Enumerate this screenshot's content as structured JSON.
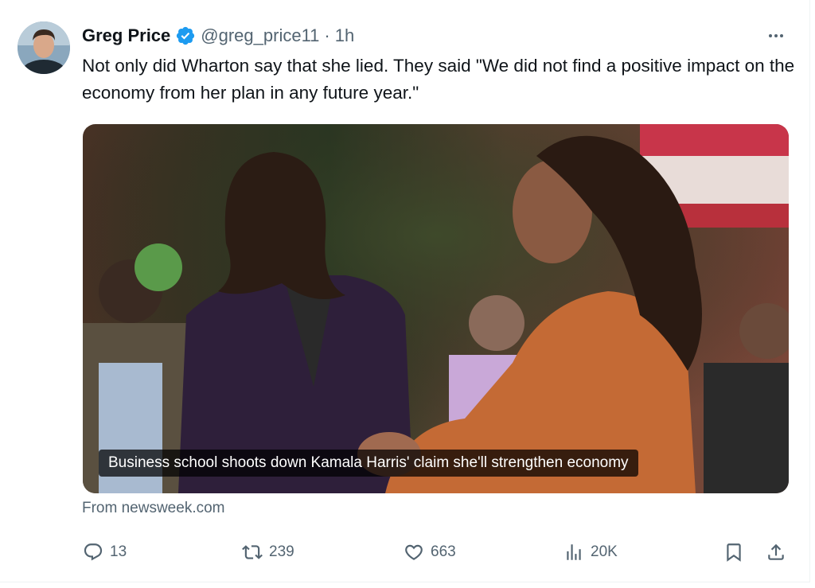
{
  "tweet": {
    "author_name": "Greg Price",
    "verified": true,
    "handle": "@greg_price11",
    "separator": "·",
    "time": "1h",
    "text": "Not only did Wharton say that she lied. They said \"We did not find a positive impact on the economy from her plan in any future year.\"",
    "card": {
      "caption": "Business school shoots down Kamala Harris' claim she'll strengthen economy",
      "source": "From newsweek.com"
    },
    "actions": {
      "replies": "13",
      "reposts": "239",
      "likes": "663",
      "views": "20K"
    }
  },
  "colors": {
    "text_primary": "#0f1419",
    "text_secondary": "#536471",
    "verified_badge": "#1d9bf0",
    "border": "#eff3f4"
  },
  "icons": [
    "more-icon",
    "verified-badge-icon",
    "reply-icon",
    "repost-icon",
    "like-icon",
    "views-icon",
    "bookmark-icon",
    "share-icon"
  ]
}
